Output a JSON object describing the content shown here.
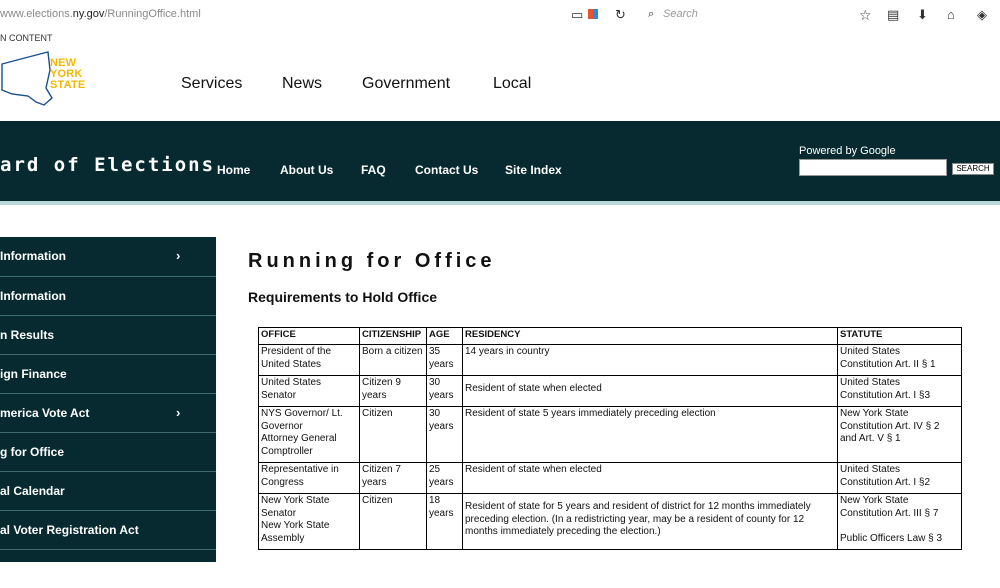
{
  "browser": {
    "url_prefix": "www.elections.",
    "url_domain": "ny.gov",
    "url_path": "/RunningOffice.html",
    "search_placeholder": "Search"
  },
  "skip_link": "N CONTENT",
  "logo": {
    "line1": "NEW",
    "line2": "YORK",
    "line3": "STATE"
  },
  "topnav": [
    "Services",
    "News",
    "Government",
    "Local"
  ],
  "agency": "ard of Elections",
  "bandnav": [
    "Home",
    "About Us",
    "FAQ",
    "Contact Us",
    "Site Index"
  ],
  "google": {
    "powered": "Powered by Google",
    "button": "SEARCH"
  },
  "sidebar": [
    {
      "label": "Information",
      "chevron": true
    },
    {
      "label": "Information",
      "chevron": false
    },
    {
      "label": "n Results",
      "chevron": false
    },
    {
      "label": "ign Finance",
      "chevron": false
    },
    {
      "label": "merica Vote Act",
      "chevron": true
    },
    {
      "label": "g for Office",
      "chevron": false
    },
    {
      "label": "al Calendar",
      "chevron": false
    },
    {
      "label": "al Voter Registration Act",
      "chevron": false
    }
  ],
  "page": {
    "title": "Running for Office",
    "subtitle": "Requirements to Hold Office"
  },
  "table": {
    "headers": [
      "OFFICE",
      "CITIZENSHIP",
      "AGE",
      "RESIDENCY",
      "STATUTE"
    ],
    "rows": [
      [
        "President of the\nUnited States",
        "Born a citizen",
        "35\nyears",
        "14 years in country",
        "United States\nConstitution Art. II § 1"
      ],
      [
        "United States\nSenator",
        "Citizen 9\nyears",
        "30\nyears",
        "Resident of state when elected",
        "United States\nConstitution Art. I §3"
      ],
      [
        "NYS Governor/ Lt.\nGovernor\nAttorney General\nComptroller",
        "Citizen",
        "30\nyears",
        "Resident of state 5 years immediately preceding election",
        "New York State\nConstitution Art. IV § 2\nand Art. V § 1"
      ],
      [
        "Representative in\nCongress",
        "Citizen 7\nyears",
        "25\nyears",
        "Resident of state when elected",
        "United States\nConstitution Art. I §2"
      ],
      [
        "New York State\nSenator\nNew York State\nAssembly",
        "Citizen",
        "18\nyears",
        "Resident of state for 5 years and resident of district for 12 months immediately preceding election. (In a redistricting year, may be a resident of county for 12 months immediately preceding the election.)",
        "New York State\nConstitution Art. III § 7\n\nPublic Officers Law § 3"
      ]
    ]
  }
}
